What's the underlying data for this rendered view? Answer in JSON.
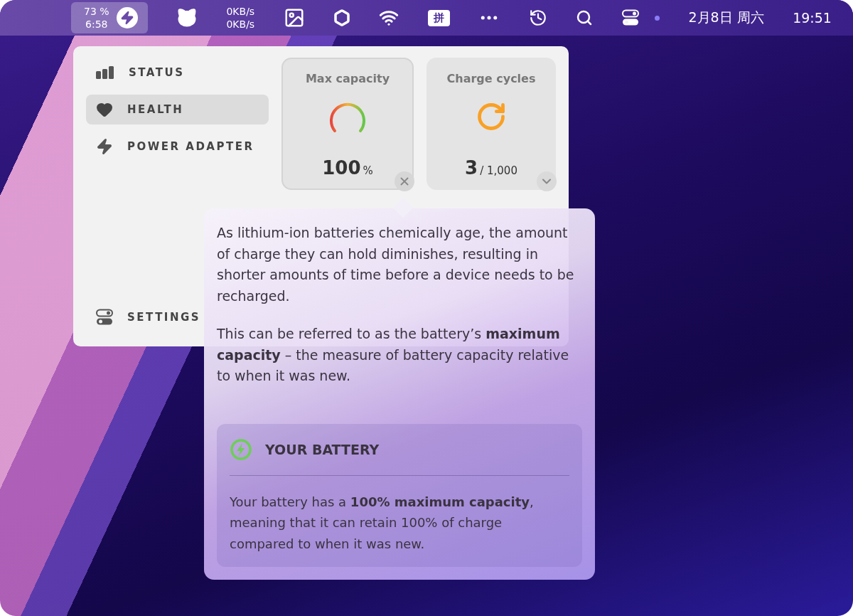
{
  "menu_bar": {
    "battery": {
      "percent": "73 %",
      "time": "6:58"
    },
    "network": {
      "upload": "0KB/s",
      "download": "0KB/s"
    },
    "input_method": "拼",
    "date": "2月8日 周六",
    "time": "19:51"
  },
  "sidebar": {
    "items": [
      {
        "label": "STATUS",
        "kind": "status",
        "selected": false
      },
      {
        "label": "HEALTH",
        "kind": "health",
        "selected": true
      },
      {
        "label": "POWER ADAPTER",
        "kind": "adapter",
        "selected": false
      },
      {
        "label": "SETTINGS",
        "kind": "settings",
        "selected": false
      }
    ]
  },
  "cards": [
    {
      "title": "Max capacity",
      "kind": "gauge",
      "value": "100",
      "unit": "%",
      "expanded": true
    },
    {
      "title": "Charge cycles",
      "kind": "cycles",
      "value": "3",
      "unit": "/ 1,000",
      "expanded": false
    }
  ],
  "popover": {
    "paragraphs": [
      "As lithium-ion batteries chemically age, the amount of charge they can hold diminishes, resulting in shorter amounts of time before a device needs to be recharged.",
      "This can be referred to as the battery’s **maximum capacity** – the measure of battery capacity relative to when it was new."
    ],
    "battery_box": {
      "title": "YOUR BATTERY",
      "text": "Your battery has a **100% maximum capacity**, meaning that it can retain 100% of charge compared to when it was new."
    }
  }
}
